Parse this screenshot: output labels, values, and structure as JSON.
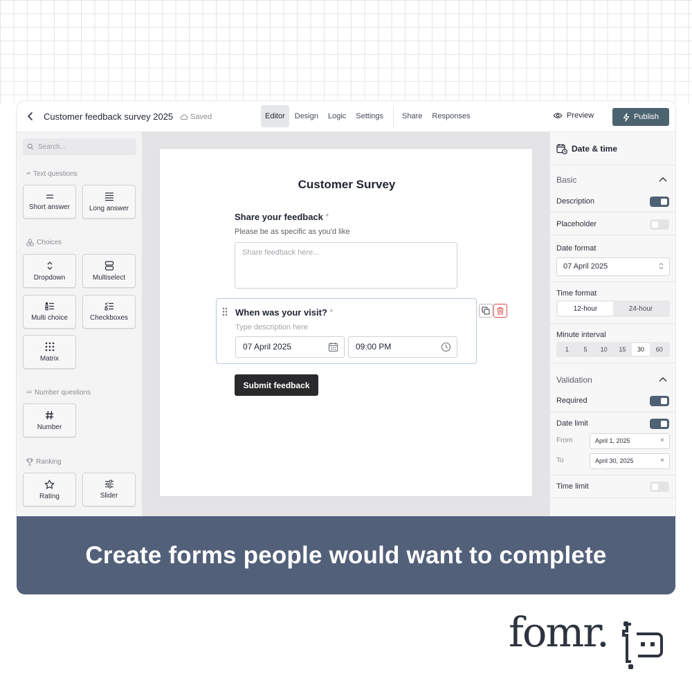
{
  "app": {
    "title": "Customer feedback survey 2025",
    "saved": "Saved",
    "tabs": [
      "Editor",
      "Design",
      "Logic",
      "Settings",
      "Share",
      "Responses"
    ],
    "active_tab": "Editor",
    "preview_label": "Preview",
    "publish_label": "Publish"
  },
  "sidebar": {
    "search_placeholder": "Search...",
    "sections": {
      "text": "Text questions",
      "choices": "Choices",
      "number": "Number questions",
      "ranking": "Ranking"
    },
    "items": {
      "short_answer": "Short answer",
      "long_answer": "Long answer",
      "dropdown": "Dropdown",
      "multiselect": "Multiselect",
      "multi_choice": "Multi choice",
      "checkboxes": "Checkboxes",
      "matrix": "Matrix",
      "number": "Number",
      "rating": "Rating",
      "slider": "Slider"
    }
  },
  "form": {
    "title": "Customer Survey",
    "q1": {
      "label": "Share your feedback",
      "required_mark": "*",
      "description": "Please be as specific as you'd like",
      "placeholder": "Share feedback here..."
    },
    "q2": {
      "label": "When was your visit?",
      "required_mark": "*",
      "description_placeholder": "Type description here",
      "date_value": "07 April 2025",
      "time_value": "09:00 PM"
    },
    "submit_label": "Submit feedback"
  },
  "panel": {
    "title": "Date & time",
    "basic": "Basic",
    "description": "Description",
    "description_on": true,
    "placeholder": "Placeholder",
    "placeholder_on": false,
    "date_format_label": "Date format",
    "date_format_value": "07 April 2025",
    "time_format_label": "Time format",
    "time_formats": [
      "12-hour",
      "24-hour"
    ],
    "time_format_selected": "12-hour",
    "minute_interval_label": "Minute interval",
    "minute_intervals": [
      "1",
      "5",
      "10",
      "15",
      "30",
      "60"
    ],
    "minute_interval_selected": "30",
    "validation": "Validation",
    "required": "Required",
    "required_on": true,
    "date_limit": "Date limit",
    "date_limit_on": true,
    "from_label": "From",
    "from_value": "April 1, 2025",
    "to_label": "To",
    "to_value": "April 30, 2025",
    "time_limit": "Time limit",
    "time_limit_on": false
  },
  "banner": {
    "headline": "Create forms people would want to complete"
  },
  "logo": {
    "text": "fomr."
  },
  "colors": {
    "publish": "#4c6470",
    "banner": "#52607a",
    "toggle_on": "#4f6174",
    "delete": "#d94a4a"
  }
}
